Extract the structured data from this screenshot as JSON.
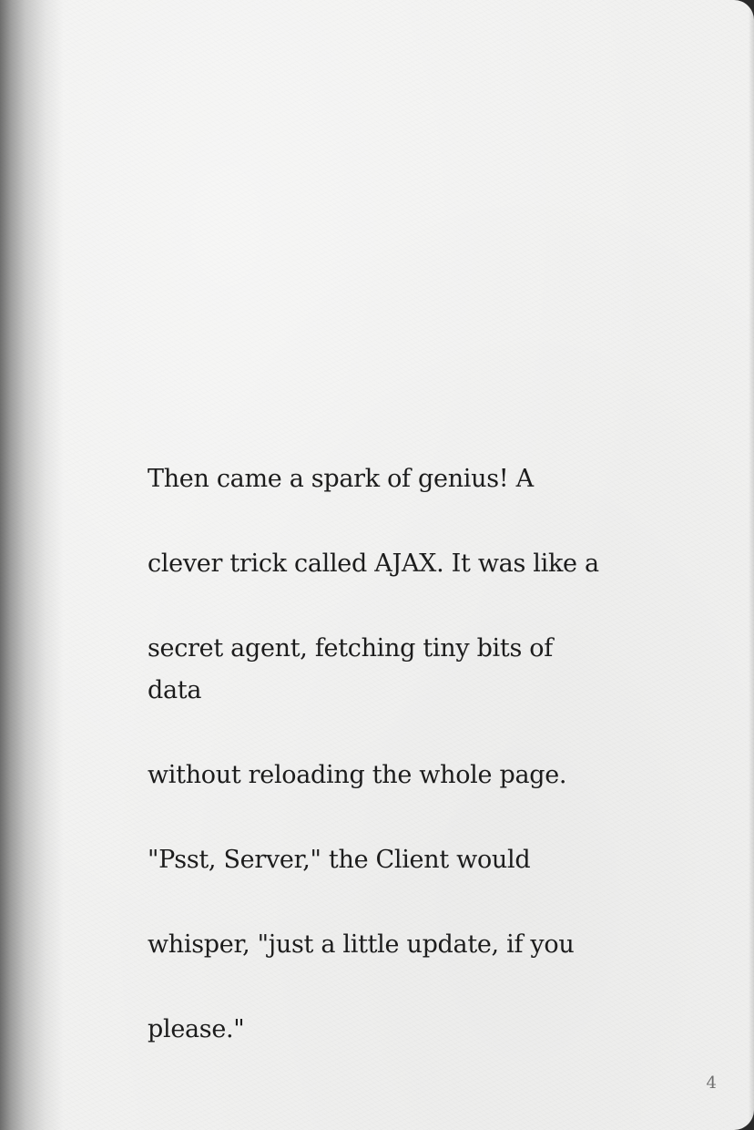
{
  "page": {
    "lines": [
      "Then came a spark of genius! A",
      "clever trick called AJAX. It was like a",
      "secret agent, fetching tiny bits of data",
      "without reloading the whole page.",
      "\"Psst, Server,\" the Client would",
      "whisper, \"just a little update, if you",
      "please.\""
    ],
    "page_number": "4"
  },
  "colors": {
    "paper": "#f1f1f0",
    "text": "#1c1c1c",
    "page_number": "#6e6e6e"
  }
}
